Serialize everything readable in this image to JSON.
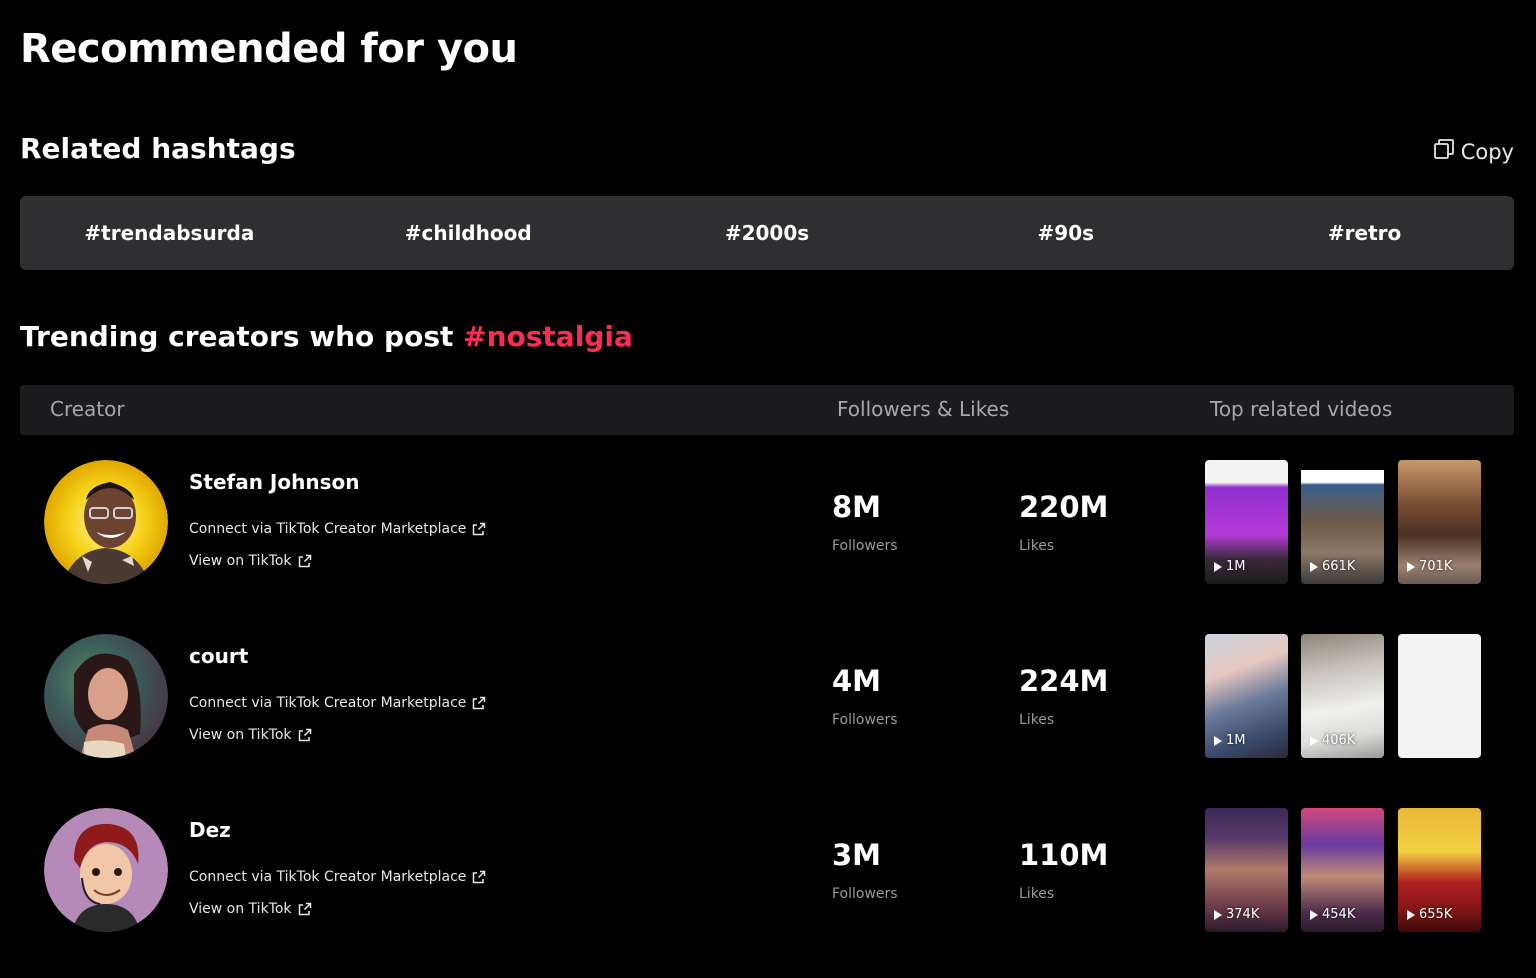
{
  "page_title": "Recommended for you",
  "hashtags_section": {
    "title": "Related hashtags",
    "copy_label": "Copy",
    "tags": [
      "#trendabsurda",
      "#childhood",
      "#2000s",
      "#90s",
      "#retro"
    ]
  },
  "trending": {
    "title_prefix": "Trending creators who post ",
    "title_hashtag": "#nostalgia",
    "columns": {
      "creator": "Creator",
      "followers_likes": "Followers & Likes",
      "top_videos": "Top related videos"
    }
  },
  "creators": [
    {
      "name": "Stefan Johnson",
      "connect_label": "Connect via TikTok Creator Marketplace",
      "view_label": "View on TikTok",
      "followers": "8M",
      "followers_label": "Followers",
      "likes": "220M",
      "likes_label": "Likes",
      "videos": [
        {
          "views": "1M"
        },
        {
          "views": "661K"
        },
        {
          "views": "701K"
        }
      ]
    },
    {
      "name": "court",
      "connect_label": "Connect via TikTok Creator Marketplace",
      "view_label": "View on TikTok",
      "followers": "4M",
      "followers_label": "Followers",
      "likes": "224M",
      "likes_label": "Likes",
      "videos": [
        {
          "views": "1M"
        },
        {
          "views": "406K"
        },
        {
          "views": ""
        }
      ]
    },
    {
      "name": "Dez",
      "connect_label": "Connect via TikTok Creator Marketplace",
      "view_label": "View on TikTok",
      "followers": "3M",
      "followers_label": "Followers",
      "likes": "110M",
      "likes_label": "Likes",
      "videos": [
        {
          "views": "374K"
        },
        {
          "views": "454K"
        },
        {
          "views": "655K"
        }
      ]
    }
  ],
  "colors": {
    "background": "#000000",
    "accent": "#fe2c55",
    "hashtag_bar": "#2f2f31",
    "table_header": "#1c1c1e"
  }
}
